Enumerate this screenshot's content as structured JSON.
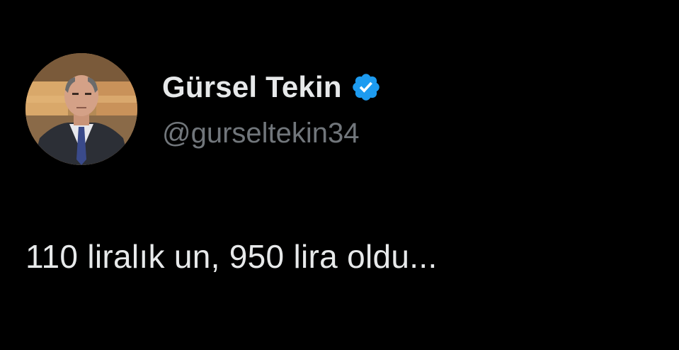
{
  "tweet": {
    "author": {
      "display_name": "Gürsel Tekin",
      "handle": "@gurseltekin34",
      "verified": true,
      "avatar_icon": "profile-photo",
      "verified_icon": "verified-badge-icon"
    },
    "text": "110 liralık un, 950 lira oldu..."
  },
  "colors": {
    "background": "#000000",
    "primary_text": "#e7e9ea",
    "secondary_text": "#71767b",
    "verified_blue": "#1d9bf0"
  }
}
